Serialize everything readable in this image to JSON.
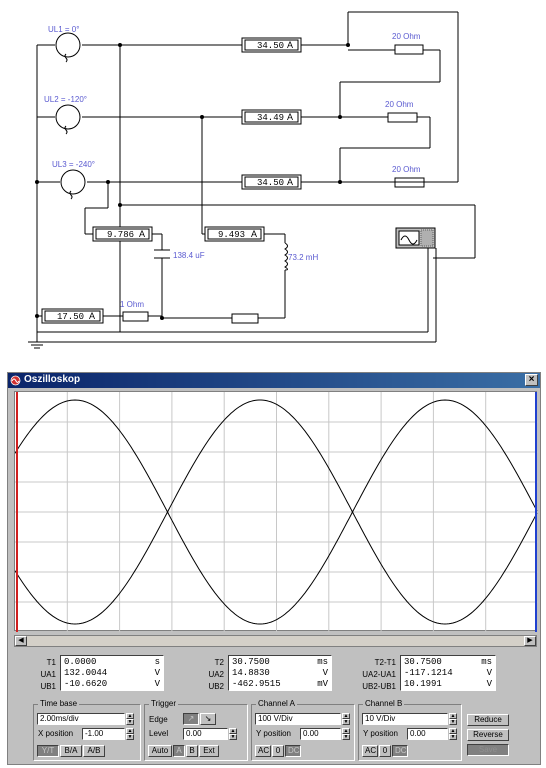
{
  "schematic": {
    "sources": [
      {
        "label": "UL1 = 0°"
      },
      {
        "label": "UL2 = -120°"
      },
      {
        "label": "UL3 = -240°"
      }
    ],
    "ammeters": [
      {
        "value": "34.50",
        "unit": "A"
      },
      {
        "value": "34.49",
        "unit": "A"
      },
      {
        "value": "34.50",
        "unit": "A"
      },
      {
        "value": "9.786",
        "unit": "A"
      },
      {
        "value": "9.493",
        "unit": "A"
      },
      {
        "value": "17.50",
        "unit": "A"
      }
    ],
    "resistors": [
      "20  Ohm",
      "20  Ohm",
      "20  Ohm",
      "1  Ohm"
    ],
    "capacitor": "138.4 uF",
    "inductor": "73.2 mH"
  },
  "window": {
    "title": "Oszilloskop",
    "close": "×",
    "line_color": "#000000",
    "cursor1_color": "#d02020",
    "cursor2_color": "#2040d0"
  },
  "meas1": {
    "labels": [
      "T1",
      "UA1",
      "UB1"
    ],
    "values": [
      "0.0000",
      "132.0044",
      "-10.6620"
    ],
    "units": [
      "s",
      "V",
      "V"
    ]
  },
  "meas2": {
    "labels": [
      "T2",
      "UA2",
      "UB2"
    ],
    "values": [
      "30.7500",
      "14.8830",
      "-462.9515"
    ],
    "units": [
      "ms",
      "V",
      "mV"
    ]
  },
  "meas3": {
    "labels": [
      "T2-T1",
      "UA2-UA1",
      "UB2-UB1"
    ],
    "values": [
      "30.7500",
      "-117.1214",
      "10.1991"
    ],
    "units": [
      "ms",
      "V",
      "V"
    ]
  },
  "timebase": {
    "title": "Time base",
    "scale": "2.00ms/div",
    "xpos_label": "X position",
    "xpos": "-1.00",
    "buttons": [
      "Y/T",
      "B/A",
      "A/B"
    ]
  },
  "trigger": {
    "title": "Trigger",
    "edge_label": "Edge",
    "level_label": "Level",
    "level": "0.00",
    "buttons": [
      "Auto",
      "A",
      "B",
      "Ext"
    ]
  },
  "channel_a": {
    "title": "Channel A",
    "scale": "100 V/Div",
    "ypos_label": "Y position",
    "ypos": "0.00",
    "buttons": [
      "AC",
      "0",
      "DC"
    ]
  },
  "channel_b": {
    "title": "Channel B",
    "scale": "10 V/Div",
    "ypos_label": "Y position",
    "ypos": "0.00",
    "buttons": [
      "AC",
      "0",
      "DC"
    ]
  },
  "side_buttons": [
    "Reduce",
    "Reverse",
    "Save"
  ]
}
